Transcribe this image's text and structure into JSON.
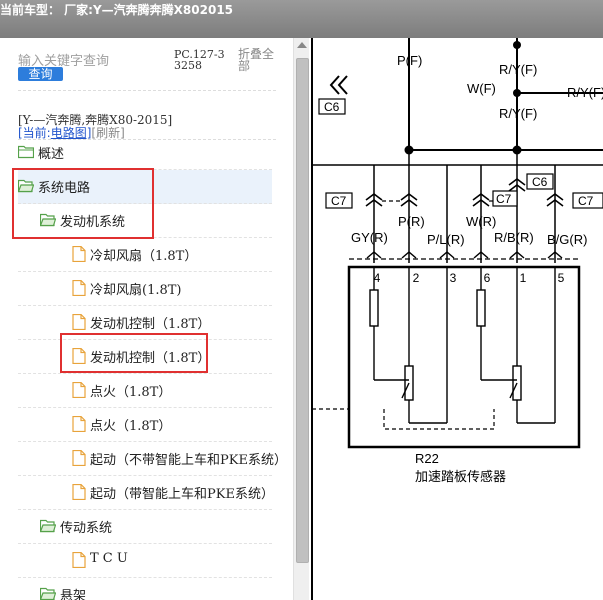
{
  "header": {
    "title": "当前车型：  厂家:Y—汽奔腾奔腾X802015"
  },
  "search": {
    "placeholder": "输入关键字查询",
    "button_label": "查询",
    "pc_code": "PC.127-33258",
    "collapse_all_label": "折叠全部"
  },
  "breadcrumb": {
    "model": "[Y-—汽奔腾,奔腾X80-2015]",
    "current_label": "[当前:",
    "current_value": "电路图]",
    "refresh_label": "[刷新]"
  },
  "tree": {
    "items": [
      {
        "label": "概述",
        "type": "folder",
        "level": 0
      },
      {
        "label": "系统电路",
        "type": "folder-open",
        "level": 0,
        "selected": true
      },
      {
        "label": "发动机系统",
        "type": "folder-open",
        "level": 1
      },
      {
        "label": "冷却风扇（1.8T）",
        "type": "doc",
        "level": 2
      },
      {
        "label": "冷却风扇(1.8T)",
        "type": "doc",
        "level": 2
      },
      {
        "label": "发动机控制（1.8T）",
        "type": "doc",
        "level": 2
      },
      {
        "label": "发动机控制（1.8T）",
        "type": "doc",
        "level": 2
      },
      {
        "label": "点火（1.8T）",
        "type": "doc",
        "level": 2
      },
      {
        "label": "点火（1.8T）",
        "type": "doc",
        "level": 2
      },
      {
        "label": "起动（不带智能上车和PKE系统）",
        "type": "doc",
        "level": 2
      },
      {
        "label": "起动（带智能上车和PKE系统）",
        "type": "doc",
        "level": 2
      },
      {
        "label": "传动系统",
        "type": "folder-open",
        "level": 1
      },
      {
        "label": "T C U",
        "type": "doc",
        "level": 2
      },
      {
        "label": "悬架",
        "type": "folder-open",
        "level": 1
      }
    ]
  },
  "diagram": {
    "labels": {
      "p_f": "P(F)",
      "r_y_f_top": "R/Y(F)",
      "w_f": "W(F)",
      "r_y_f_right": "R/Y(F)",
      "r_y_f_mid": "R/Y(F)",
      "c6_left": "C6",
      "c6_mid": "C6",
      "c7_left": "C7",
      "c7_mid": "C7",
      "c7_right": "C7",
      "p_r": "P(R)",
      "w_r": "W(R)",
      "gy_r": "GY(R)",
      "p_l_r": "P/L(R)",
      "r_b_r": "R/B(R)",
      "b_g_r": "B/G(R)",
      "pin4": "4",
      "pin2": "2",
      "pin3": "3",
      "pin6": "6",
      "pin1": "1",
      "pin5": "5",
      "component_id": "R22",
      "component_name": "加速踏板传感器"
    }
  },
  "colors": {
    "title_bar": "#8a8a8a",
    "button": "#2d7ddc",
    "highlight_box": "#e03030",
    "link": "#2255cc",
    "folder_icon": "#55a14a",
    "doc_icon": "#e8a33b"
  }
}
